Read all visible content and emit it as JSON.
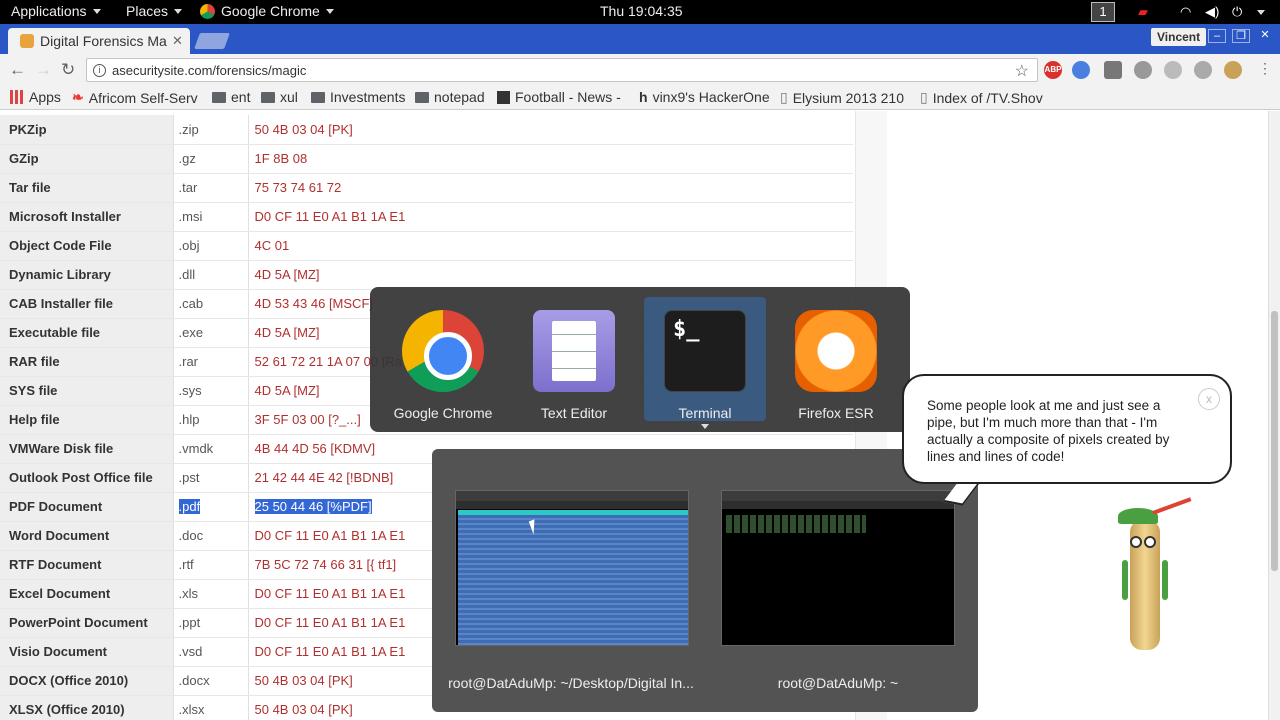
{
  "topbar": {
    "applications": "Applications",
    "places": "Places",
    "active_app": "Google Chrome",
    "clock": "Thu 19:04:35",
    "workspace": "1"
  },
  "browser": {
    "tab_title": "Digital Forensics Ma",
    "user": "Vincent",
    "url": "asecuritysite.com/forensics/magic",
    "bookmarks": [
      "Apps",
      "Africom Self-Serv",
      "ent",
      "xul",
      "Investments",
      "notepad",
      "Football - News -",
      "vinx9's HackerOne",
      "Elysium 2013 210",
      "Index of /TV.Shov"
    ],
    "extensions": [
      "ABP"
    ]
  },
  "table": {
    "rows": [
      {
        "name": "PKZip",
        "ext": ".zip",
        "hex": "50 4B 03 04 [PK]"
      },
      {
        "name": "GZip",
        "ext": ".gz",
        "hex": "1F 8B 08"
      },
      {
        "name": "Tar file",
        "ext": ".tar",
        "hex": "75 73 74 61 72"
      },
      {
        "name": "Microsoft Installer",
        "ext": ".msi",
        "hex": "D0 CF 11 E0 A1 B1 1A E1"
      },
      {
        "name": "Object Code File",
        "ext": ".obj",
        "hex": "4C 01"
      },
      {
        "name": "Dynamic Library",
        "ext": ".dll",
        "hex": "4D 5A [MZ]"
      },
      {
        "name": "CAB Installer file",
        "ext": ".cab",
        "hex": "4D 53 43 46 [MSCF]"
      },
      {
        "name": "Executable file",
        "ext": ".exe",
        "hex": "4D 5A [MZ]"
      },
      {
        "name": "RAR file",
        "ext": ".rar",
        "hex": "52 61 72 21 1A 07 00 [Ra"
      },
      {
        "name": "SYS file",
        "ext": ".sys",
        "hex": "4D 5A [MZ]"
      },
      {
        "name": "Help file",
        "ext": ".hlp",
        "hex": "3F 5F 03 00 [?_...]"
      },
      {
        "name": "VMWare Disk file",
        "ext": ".vmdk",
        "hex": "4B 44 4D 56 [KDMV]"
      },
      {
        "name": "Outlook Post Office file",
        "ext": ".pst",
        "hex": "21 42 44 4E 42 [!BDNB]"
      },
      {
        "name": "PDF Document",
        "ext": ".pdf",
        "hex": "25 50 44 46 [%PDF]"
      },
      {
        "name": "Word Document",
        "ext": ".doc",
        "hex": "D0 CF 11 E0 A1 B1 1A E1"
      },
      {
        "name": "RTF Document",
        "ext": ".rtf",
        "hex": "7B 5C 72 74 66 31 [{ tf1]"
      },
      {
        "name": "Excel Document",
        "ext": ".xls",
        "hex": "D0 CF 11 E0 A1 B1 1A E1"
      },
      {
        "name": "PowerPoint Document",
        "ext": ".ppt",
        "hex": "D0 CF 11 E0 A1 B1 1A E1"
      },
      {
        "name": "Visio Document",
        "ext": ".vsd",
        "hex": "D0 CF 11 E0 A1 B1 1A E1"
      },
      {
        "name": "DOCX (Office 2010)",
        "ext": ".docx",
        "hex": "50 4B 03 04 [PK]"
      },
      {
        "name": "XLSX (Office 2010)",
        "ext": ".xlsx",
        "hex": "50 4B 03 04 [PK]"
      }
    ],
    "selected_row": "PDF Document"
  },
  "switcher": {
    "apps": [
      {
        "label": "Google Chrome",
        "icon": "chrome-icon"
      },
      {
        "label": "Text Editor",
        "icon": "text-editor-icon"
      },
      {
        "label": "Terminal",
        "icon": "terminal-icon",
        "glyph": "$_"
      },
      {
        "label": "Firefox ESR",
        "icon": "firefox-icon"
      }
    ],
    "selected": "Terminal",
    "windows": [
      {
        "caption": "root@DatAduMp: ~/Desktop/Digital In..."
      },
      {
        "caption": "root@DatAduMp: ~"
      }
    ]
  },
  "assistant": {
    "message": "Some people look at me and just see a pipe, but I'm much more than that - I'm actually a composite of pixels created by lines and lines of code!",
    "close": "x"
  },
  "colors": {
    "accent_selection": "#3367d6",
    "hex_text": "#b03030",
    "chrome_frame": "#2a56c6"
  }
}
